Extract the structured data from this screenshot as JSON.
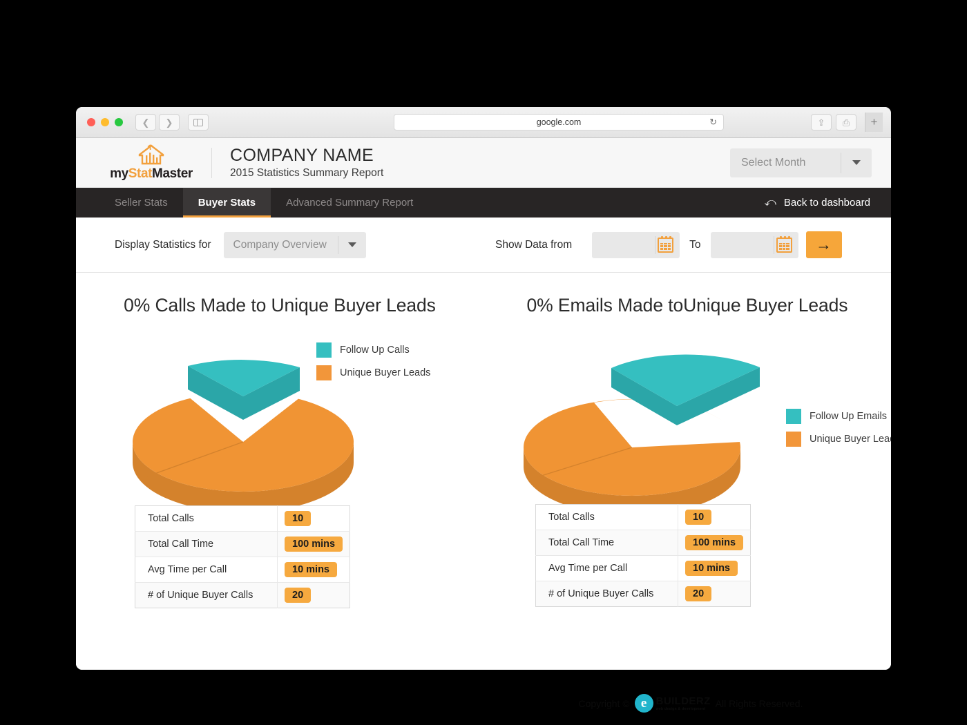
{
  "browser": {
    "url": "google.com",
    "back_icon": "chevron-left-icon",
    "forward_icon": "chevron-right-icon",
    "sidebar_icon": "sidebar-toggle-icon",
    "reload_icon": "reload-icon",
    "share_icon": "share-icon",
    "tabs_icon": "tab-overview-icon",
    "new_tab_icon": "plus-icon"
  },
  "header": {
    "logo_my": "my",
    "logo_stat": "Stat",
    "logo_master": "Master",
    "company_name": "COMPANY NAME",
    "report_subtitle": "2015 Statistics Summary Report",
    "month_select": {
      "value": "Select Month",
      "caret_icon": "chevron-down-icon"
    }
  },
  "nav": {
    "tabs": [
      {
        "label": "Seller Stats",
        "active": false
      },
      {
        "label": "Buyer Stats",
        "active": true
      },
      {
        "label": "Advanced Summary Report",
        "active": false
      }
    ],
    "back_link": "Back to dashboard",
    "back_icon": "back-arrow-icon"
  },
  "filters": {
    "display_label": "Display Statistics for",
    "overview_select": {
      "value": "Company Overview",
      "caret_icon": "chevron-down-icon"
    },
    "show_data_label": "Show Data from",
    "to_label": "To",
    "date_from": "",
    "date_to": "",
    "date_placeholder": "",
    "calendar_icon": "calendar-icon",
    "go_icon": "arrow-right-icon",
    "go_label": "→"
  },
  "charts": [
    {
      "title": "0% Calls Made to Unique Buyer Leads",
      "legend": [
        {
          "label": "Follow Up Calls",
          "color": "#35bfc0"
        },
        {
          "label": "Unique Buyer Leads",
          "color": "#f2963a"
        }
      ],
      "table": {
        "rows": [
          {
            "key": "Total Calls",
            "value": "10"
          },
          {
            "key": "Total Call Time",
            "value": "100 mins"
          },
          {
            "key": "Avg Time per Call",
            "value": "10 mins"
          },
          {
            "key": "# of Unique Buyer Calls",
            "value": "20"
          }
        ]
      }
    },
    {
      "title": "0% Emails Made toUnique Buyer Leads",
      "legend": [
        {
          "label": "Follow Up Emails",
          "color": "#35bfc0"
        },
        {
          "label": "Unique Buyer Leads",
          "color": "#f2963a"
        }
      ],
      "table": {
        "rows": [
          {
            "key": "Total Calls",
            "value": "10"
          },
          {
            "key": "Total Call Time",
            "value": "100 mins"
          },
          {
            "key": "Avg Time per Call",
            "value": "10 mins"
          },
          {
            "key": "# of Unique Buyer Calls",
            "value": "20"
          }
        ]
      }
    }
  ],
  "chart_data": [
    {
      "type": "pie",
      "title": "0% Calls Made to Unique Buyer Leads",
      "three_d": true,
      "exploded_slice": "Follow Up Calls",
      "labels": [
        "Follow Up Calls",
        "Unique Buyer Leads"
      ],
      "values": [
        33,
        67
      ],
      "colors": [
        "#35bfc0",
        "#f2963a"
      ],
      "legend_position": "right",
      "percent_label": "0%"
    },
    {
      "type": "pie",
      "title": "0% Emails Made toUnique Buyer Leads",
      "three_d": true,
      "exploded_slice": "Follow Up Emails",
      "labels": [
        "Follow Up Emails",
        "Unique Buyer Leads"
      ],
      "values": [
        33,
        67
      ],
      "colors": [
        "#35bfc0",
        "#f2963a"
      ],
      "legend_position": "right",
      "percent_label": "0%"
    }
  ],
  "footer": {
    "copyright_prefix": "Copyright ©",
    "brand_e": "e",
    "brand_name": "BUILDERZ",
    "brand_tagline": "web design & development",
    "copyright_suffix": "All Rights Reserved."
  },
  "colors": {
    "accent_orange": "#f2a03d",
    "teal": "#35bfc0",
    "nav_dark": "#282525",
    "nav_active": "#3a3737"
  }
}
